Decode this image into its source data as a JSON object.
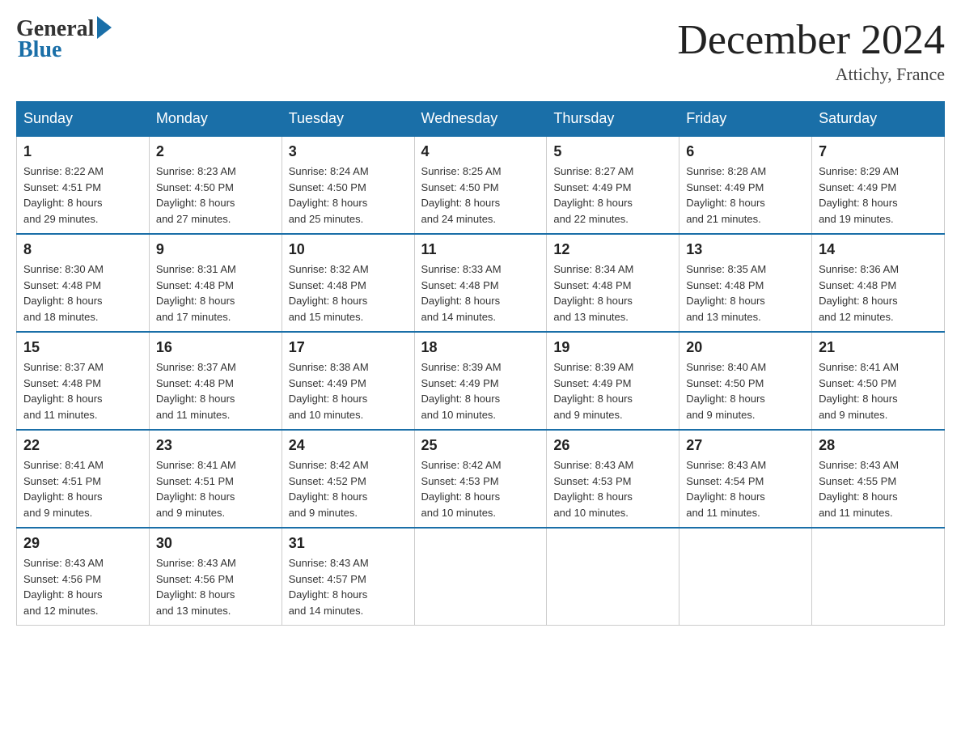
{
  "header": {
    "logo_general": "General",
    "logo_blue": "Blue",
    "title": "December 2024",
    "location": "Attichy, France"
  },
  "days_of_week": [
    "Sunday",
    "Monday",
    "Tuesday",
    "Wednesday",
    "Thursday",
    "Friday",
    "Saturday"
  ],
  "weeks": [
    [
      {
        "day": "1",
        "sunrise": "8:22 AM",
        "sunset": "4:51 PM",
        "daylight": "8 hours and 29 minutes."
      },
      {
        "day": "2",
        "sunrise": "8:23 AM",
        "sunset": "4:50 PM",
        "daylight": "8 hours and 27 minutes."
      },
      {
        "day": "3",
        "sunrise": "8:24 AM",
        "sunset": "4:50 PM",
        "daylight": "8 hours and 25 minutes."
      },
      {
        "day": "4",
        "sunrise": "8:25 AM",
        "sunset": "4:50 PM",
        "daylight": "8 hours and 24 minutes."
      },
      {
        "day": "5",
        "sunrise": "8:27 AM",
        "sunset": "4:49 PM",
        "daylight": "8 hours and 22 minutes."
      },
      {
        "day": "6",
        "sunrise": "8:28 AM",
        "sunset": "4:49 PM",
        "daylight": "8 hours and 21 minutes."
      },
      {
        "day": "7",
        "sunrise": "8:29 AM",
        "sunset": "4:49 PM",
        "daylight": "8 hours and 19 minutes."
      }
    ],
    [
      {
        "day": "8",
        "sunrise": "8:30 AM",
        "sunset": "4:48 PM",
        "daylight": "8 hours and 18 minutes."
      },
      {
        "day": "9",
        "sunrise": "8:31 AM",
        "sunset": "4:48 PM",
        "daylight": "8 hours and 17 minutes."
      },
      {
        "day": "10",
        "sunrise": "8:32 AM",
        "sunset": "4:48 PM",
        "daylight": "8 hours and 15 minutes."
      },
      {
        "day": "11",
        "sunrise": "8:33 AM",
        "sunset": "4:48 PM",
        "daylight": "8 hours and 14 minutes."
      },
      {
        "day": "12",
        "sunrise": "8:34 AM",
        "sunset": "4:48 PM",
        "daylight": "8 hours and 13 minutes."
      },
      {
        "day": "13",
        "sunrise": "8:35 AM",
        "sunset": "4:48 PM",
        "daylight": "8 hours and 13 minutes."
      },
      {
        "day": "14",
        "sunrise": "8:36 AM",
        "sunset": "4:48 PM",
        "daylight": "8 hours and 12 minutes."
      }
    ],
    [
      {
        "day": "15",
        "sunrise": "8:37 AM",
        "sunset": "4:48 PM",
        "daylight": "8 hours and 11 minutes."
      },
      {
        "day": "16",
        "sunrise": "8:37 AM",
        "sunset": "4:48 PM",
        "daylight": "8 hours and 11 minutes."
      },
      {
        "day": "17",
        "sunrise": "8:38 AM",
        "sunset": "4:49 PM",
        "daylight": "8 hours and 10 minutes."
      },
      {
        "day": "18",
        "sunrise": "8:39 AM",
        "sunset": "4:49 PM",
        "daylight": "8 hours and 10 minutes."
      },
      {
        "day": "19",
        "sunrise": "8:39 AM",
        "sunset": "4:49 PM",
        "daylight": "8 hours and 9 minutes."
      },
      {
        "day": "20",
        "sunrise": "8:40 AM",
        "sunset": "4:50 PM",
        "daylight": "8 hours and 9 minutes."
      },
      {
        "day": "21",
        "sunrise": "8:41 AM",
        "sunset": "4:50 PM",
        "daylight": "8 hours and 9 minutes."
      }
    ],
    [
      {
        "day": "22",
        "sunrise": "8:41 AM",
        "sunset": "4:51 PM",
        "daylight": "8 hours and 9 minutes."
      },
      {
        "day": "23",
        "sunrise": "8:41 AM",
        "sunset": "4:51 PM",
        "daylight": "8 hours and 9 minutes."
      },
      {
        "day": "24",
        "sunrise": "8:42 AM",
        "sunset": "4:52 PM",
        "daylight": "8 hours and 9 minutes."
      },
      {
        "day": "25",
        "sunrise": "8:42 AM",
        "sunset": "4:53 PM",
        "daylight": "8 hours and 10 minutes."
      },
      {
        "day": "26",
        "sunrise": "8:43 AM",
        "sunset": "4:53 PM",
        "daylight": "8 hours and 10 minutes."
      },
      {
        "day": "27",
        "sunrise": "8:43 AM",
        "sunset": "4:54 PM",
        "daylight": "8 hours and 11 minutes."
      },
      {
        "day": "28",
        "sunrise": "8:43 AM",
        "sunset": "4:55 PM",
        "daylight": "8 hours and 11 minutes."
      }
    ],
    [
      {
        "day": "29",
        "sunrise": "8:43 AM",
        "sunset": "4:56 PM",
        "daylight": "8 hours and 12 minutes."
      },
      {
        "day": "30",
        "sunrise": "8:43 AM",
        "sunset": "4:56 PM",
        "daylight": "8 hours and 13 minutes."
      },
      {
        "day": "31",
        "sunrise": "8:43 AM",
        "sunset": "4:57 PM",
        "daylight": "8 hours and 14 minutes."
      },
      null,
      null,
      null,
      null
    ]
  ],
  "labels": {
    "sunrise": "Sunrise:",
    "sunset": "Sunset:",
    "daylight": "Daylight:"
  }
}
